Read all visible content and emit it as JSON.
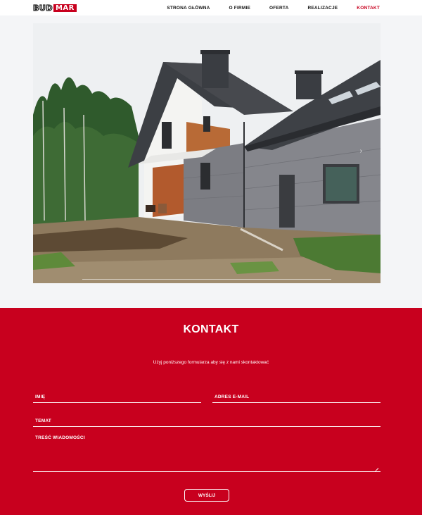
{
  "header": {
    "logo": {
      "part1": "BUD",
      "part2": "MAR"
    },
    "nav": [
      {
        "label": "STRONA GŁÓWNA",
        "active": false
      },
      {
        "label": "O FIRMIE",
        "active": false
      },
      {
        "label": "OFERTA",
        "active": false
      },
      {
        "label": "REALIZACJE",
        "active": false
      },
      {
        "label": "KONTAKT",
        "active": true
      }
    ]
  },
  "hero": {
    "image": "house-under-construction-photo",
    "next_arrow": "›"
  },
  "contact": {
    "title": "KONTAKT",
    "subtitle": "Użyj poniższego formularza aby się z nami skontaktować",
    "fields": {
      "name": "IMIĘ",
      "email": "ADRES E-MAIL",
      "subject": "TEMAT",
      "message": "TREŚĆ WIADOMOŚCI"
    },
    "submit": "WYŚLIJ"
  },
  "colors": {
    "accent": "#c8001e",
    "page_bg": "#f4f5f7",
    "text": "#111111"
  }
}
